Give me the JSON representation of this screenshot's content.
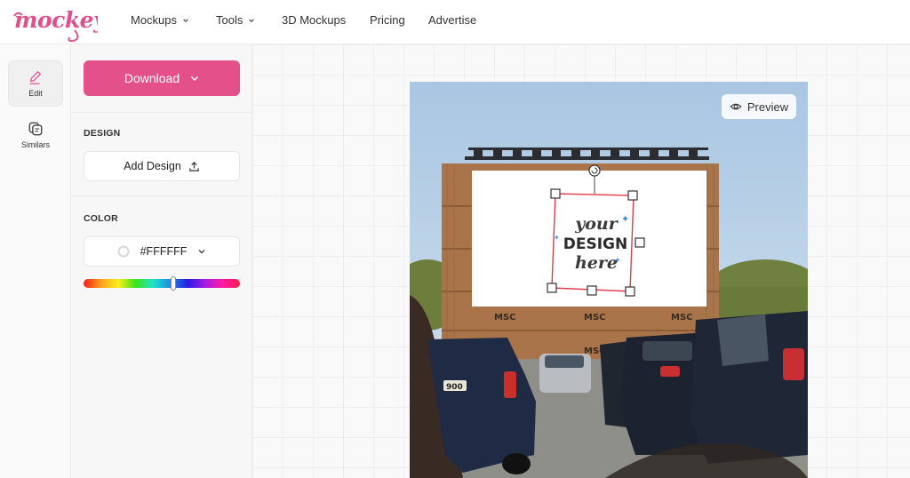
{
  "brand": {
    "logo_text": "mockey",
    "accent": "#e4508a"
  },
  "nav": {
    "items": [
      {
        "label": "Mockups",
        "has_dropdown": true
      },
      {
        "label": "Tools",
        "has_dropdown": true
      },
      {
        "label": "3D Mockups",
        "has_dropdown": false
      },
      {
        "label": "Pricing",
        "has_dropdown": false
      },
      {
        "label": "Advertise",
        "has_dropdown": false
      }
    ]
  },
  "rail": {
    "items": [
      {
        "label": "Edit",
        "icon": "pencil-icon",
        "active": true
      },
      {
        "label": "Similars",
        "icon": "layers-icon",
        "active": false
      }
    ]
  },
  "panel": {
    "download_label": "Download",
    "design_heading": "DESIGN",
    "add_design_label": "Add Design",
    "color_heading": "COLOR",
    "color_value": "#FFFFFF",
    "hue_position": 0.67
  },
  "canvas": {
    "preview_label": "Preview",
    "billboard_text": {
      "line1": "your",
      "line2": "DESIGN",
      "line3": "here"
    },
    "container_text": "MSC",
    "plate_text": "900"
  }
}
